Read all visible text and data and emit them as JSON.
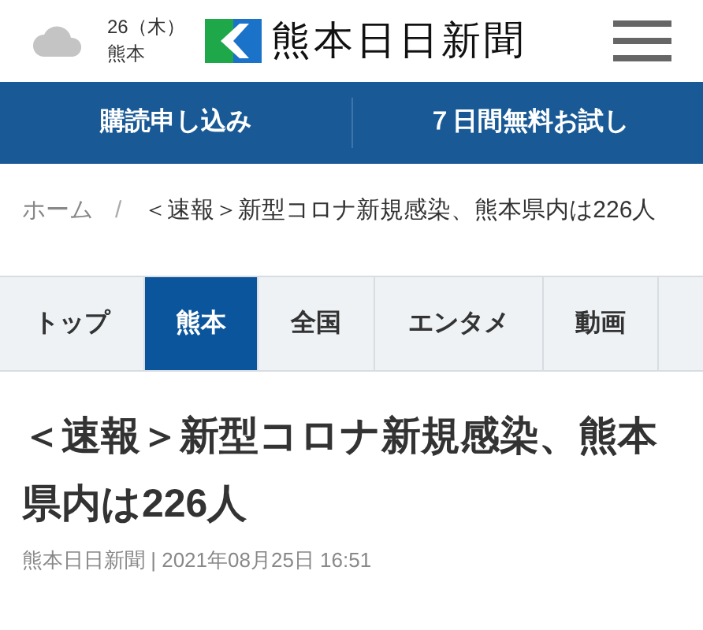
{
  "weather": {
    "date": "26（木）",
    "place": "熊本"
  },
  "logo": {
    "text": "熊本日日新聞"
  },
  "promo_links": [
    "購読申し込み",
    "７日間無料お試し"
  ],
  "breadcrumb": {
    "home": "ホーム",
    "separator": "/",
    "current": "＜速報＞新型コロナ新規感染、熊本県内は226人"
  },
  "tabs": [
    {
      "label": "トップ",
      "selected": false
    },
    {
      "label": "熊本",
      "selected": true
    },
    {
      "label": "全国",
      "selected": false
    },
    {
      "label": "エンタメ",
      "selected": false
    },
    {
      "label": "動画",
      "selected": false
    }
  ],
  "article": {
    "title": "＜速報＞新型コロナ新規感染、熊本県内は226人",
    "meta": "熊本日日新聞 | 2021年08月25日 16:51"
  }
}
